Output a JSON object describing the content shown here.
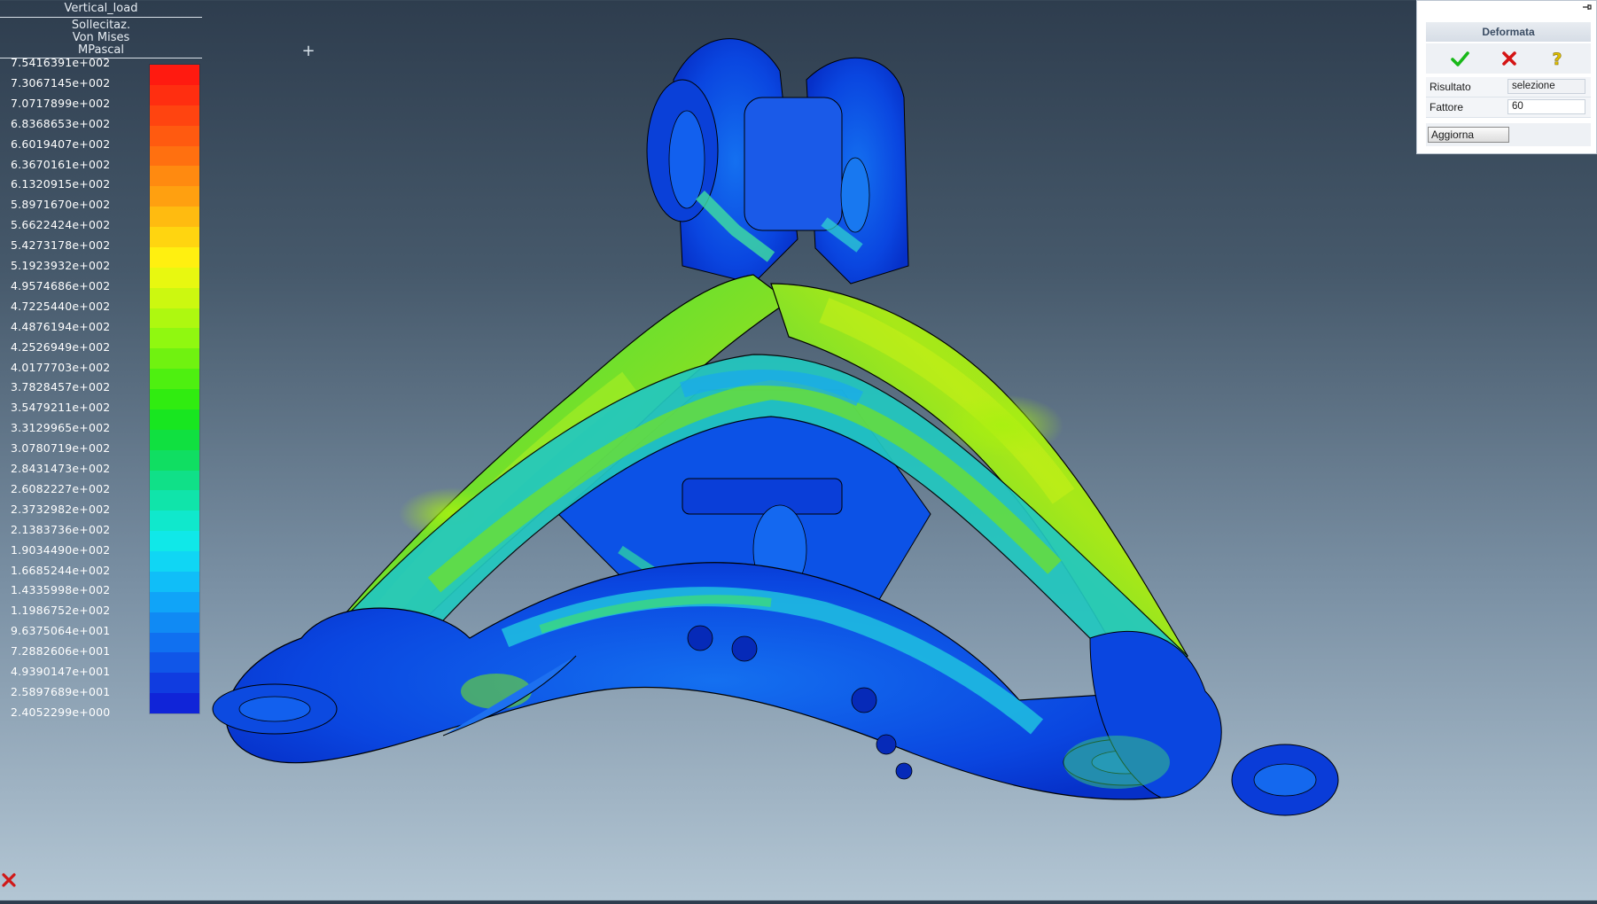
{
  "legend": {
    "load_case": "Vertical_load",
    "quantity_line1": "Sollecitaz.",
    "quantity_line2": "Von Mises",
    "unit": "MPascal",
    "values": [
      "7.5416391e+002",
      "7.3067145e+002",
      "7.0717899e+002",
      "6.8368653e+002",
      "6.6019407e+002",
      "6.3670161e+002",
      "6.1320915e+002",
      "5.8971670e+002",
      "5.6622424e+002",
      "5.4273178e+002",
      "5.1923932e+002",
      "4.9574686e+002",
      "4.7225440e+002",
      "4.4876194e+002",
      "4.2526949e+002",
      "4.0177703e+002",
      "3.7828457e+002",
      "3.5479211e+002",
      "3.3129965e+002",
      "3.0780719e+002",
      "2.8431473e+002",
      "2.6082227e+002",
      "2.3732982e+002",
      "2.1383736e+002",
      "1.9034490e+002",
      "1.6685244e+002",
      "1.4335998e+002",
      "1.1986752e+002",
      "9.6375064e+001",
      "7.2882606e+001",
      "4.9390147e+001",
      "2.5897689e+001",
      "2.4052299e+000"
    ],
    "colors": [
      "#ff1a10",
      "#ff2e10",
      "#ff4410",
      "#ff5a10",
      "#ff7010",
      "#ff8a10",
      "#ffa010",
      "#ffbb10",
      "#ffd510",
      "#fff010",
      "#e8f810",
      "#ccf810",
      "#aef810",
      "#90f810",
      "#70f210",
      "#4ef010",
      "#30ec10",
      "#18e620",
      "#10e040",
      "#10de62",
      "#10e088",
      "#10e4aa",
      "#10e8cc",
      "#10e8e8",
      "#10d6f4",
      "#10bef8",
      "#10a4f8",
      "#108af4",
      "#1070f0",
      "#1056e8",
      "#103ce0",
      "#1024d8"
    ]
  },
  "dialog": {
    "title": "Deformata",
    "pin_icon": "pin-icon",
    "confirm_icon": "checkmark-icon",
    "cancel_icon": "x-icon",
    "help_icon": "question-icon",
    "result_label": "Risultato",
    "result_value": "selezione",
    "factor_label": "Fattore",
    "factor_value": "60",
    "update_label": "Aggiorna"
  }
}
